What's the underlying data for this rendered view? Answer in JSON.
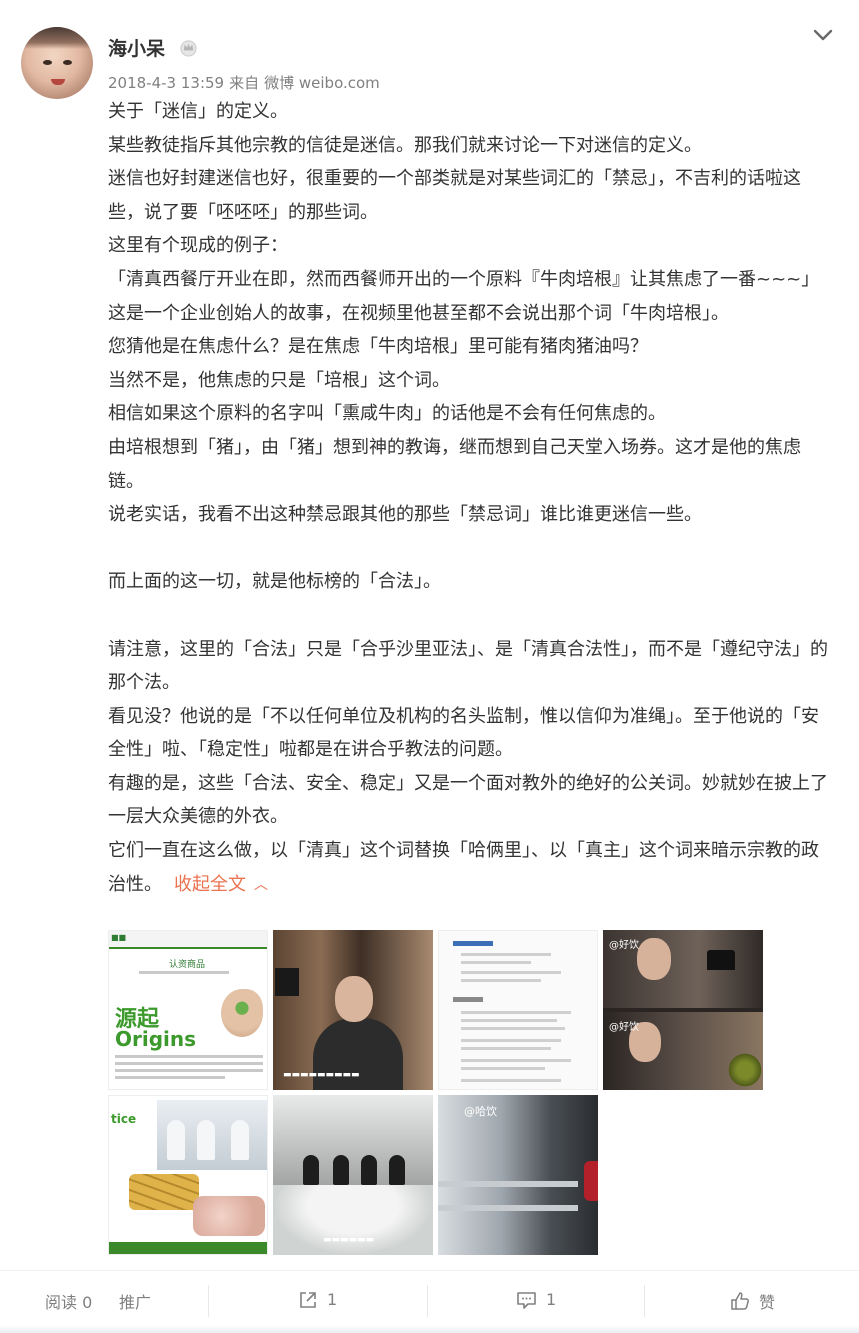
{
  "post": {
    "username": "海小呆",
    "timestamp": "2018-4-3 13:59",
    "source_prefix": "来自",
    "source_name": "微博 weibo.com",
    "paragraphs": [
      "关于「迷信」的定义。",
      "某些教徒指斥其他宗教的信徒是迷信。那我们就来讨论一下对迷信的定义。",
      "迷信也好封建迷信也好，很重要的一个部类就是对某些词汇的「禁忌」，不吉利的话啦这些，说了要「呸呸呸」的那些词。",
      "这里有个现成的例子：",
      "「清真西餐厅开业在即，然而西餐师开出的一个原料『牛肉培根』让其焦虑了一番~~~」",
      "这是一个企业创始人的故事，在视频里他甚至都不会说出那个词「牛肉培根」。",
      "您猜他是在焦虑什么？是在焦虑「牛肉培根」里可能有猪肉猪油吗？",
      "当然不是，他焦虑的只是「培根」这个词。",
      "相信如果这个原料的名字叫「熏咸牛肉」的话他是不会有任何焦虑的。",
      "由培根想到「猪」，由「猪」想到神的教诲，继而想到自己天堂入场券。这才是他的焦虑链。",
      "说老实话，我看不出这种禁忌跟其他的那些「禁忌词」谁比谁更迷信一些。",
      "",
      "而上面的这一切，就是他标榜的「合法」。",
      "",
      "请注意，这里的「合法」只是「合乎沙里亚法」、是「清真合法性」，而不是「遵纪守法」的那个法。",
      "看见没？他说的是「不以任何单位及机构的名头监制，惟以信仰为准绳」。至于他说的「安全性」啦、「稳定性」啦都是在讲合乎教法的问题。",
      "有趣的是，这些「合法、安全、稳定」又是一个面对教外的绝好的公关词。妙就妙在披上了一层大众美德的外衣。"
    ],
    "last_paragraph": "它们一直在这么做，以「清真」这个词替换「哈俩里」、以「真主」这个词来暗示宗教的政治性。",
    "collapse_label": "收起全文",
    "images": {
      "t1": {
        "title1": "源起",
        "title2": "Origins",
        "sub": "认资商品"
      },
      "t4": {
        "watermark": "@好饮"
      },
      "t5": {
        "label": "tice"
      },
      "t7": {
        "watermark": "@哈饮"
      }
    }
  },
  "footer": {
    "read_label": "阅读",
    "read_count": "0",
    "promote_label": "推广",
    "share_count": "1",
    "comment_count": "1",
    "like_label": "赞"
  },
  "colors": {
    "accent": "#eb7350",
    "text": "#333333",
    "meta": "#808080"
  }
}
